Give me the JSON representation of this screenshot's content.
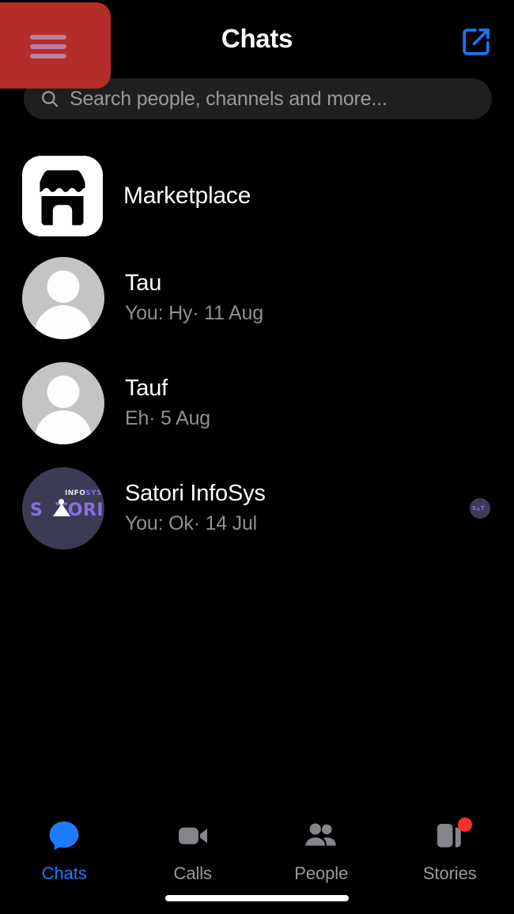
{
  "header": {
    "title": "Chats",
    "compose_icon": "compose-pencil-square-icon",
    "compose_color": "#1877f2",
    "menu_icon": "hamburger-menu-icon",
    "menu_bg_color": "#b52d28",
    "menu_line_color": "#bd7fa5"
  },
  "search": {
    "placeholder": "Search people, channels and more...",
    "icon": "search-magnifier-icon",
    "value": "",
    "bg_color": "#1f1f1f"
  },
  "chats": [
    {
      "name": "Marketplace",
      "snippet": "",
      "avatar_type": "marketplace-tile",
      "avatar_icon": "marketplace-storefront-icon"
    },
    {
      "name": "Tau",
      "snippet": "You: Hy· 11 Aug",
      "avatar_type": "default-person",
      "avatar_color": "#c4c4c4"
    },
    {
      "name": "Tauf",
      "snippet": "Eh· 5 Aug",
      "avatar_type": "default-person",
      "avatar_color": "#c4c4c4"
    },
    {
      "name": "Satori InfoSys",
      "snippet": "You: Ok· 14 Jul",
      "avatar_type": "satori-logo",
      "avatar_color": "#3b3b55",
      "logo_text_s": "S",
      "logo_text_tori": "TORI",
      "logo_superscript_info": "INFO",
      "logo_superscript_sys": "SYS",
      "seen_badge": "seen-by-satori-avatar"
    }
  ],
  "bottom_nav": [
    {
      "label": "Chats",
      "icon": "chat-bubble-icon",
      "active": true,
      "color": "#1e7bff",
      "badge": ""
    },
    {
      "label": "Calls",
      "icon": "video-camera-icon",
      "active": false,
      "color": "#83858b",
      "badge": ""
    },
    {
      "label": "People",
      "icon": "people-group-icon",
      "active": false,
      "color": "#83858b",
      "badge": ""
    },
    {
      "label": "Stories",
      "icon": "stories-cards-icon",
      "active": false,
      "color": "#83858b",
      "badge": "notification-dot"
    }
  ],
  "system": {
    "home_indicator": "home-indicator-bar"
  }
}
